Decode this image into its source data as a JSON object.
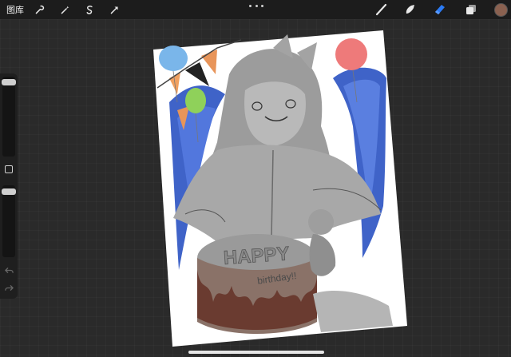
{
  "topbar": {
    "gallery_label": "图库",
    "left_tools": [
      "wrench-icon",
      "magic-wand-icon",
      "selection-icon",
      "transform-arrow-icon"
    ],
    "right_tools": [
      "brush-icon",
      "smudge-icon",
      "eraser-icon",
      "layers-icon"
    ],
    "active_tool": "eraser-icon",
    "accent_color": "#2b7bf5",
    "current_color": "#8a6150"
  },
  "sidebar": {
    "brush_size_level": 0.97,
    "opacity_level": 0.98,
    "undo_icon": "undo-icon",
    "redo_icon": "redo-icon"
  },
  "artwork": {
    "cake_text_1": "HAPPY",
    "cake_text_2": "birthday!!"
  }
}
